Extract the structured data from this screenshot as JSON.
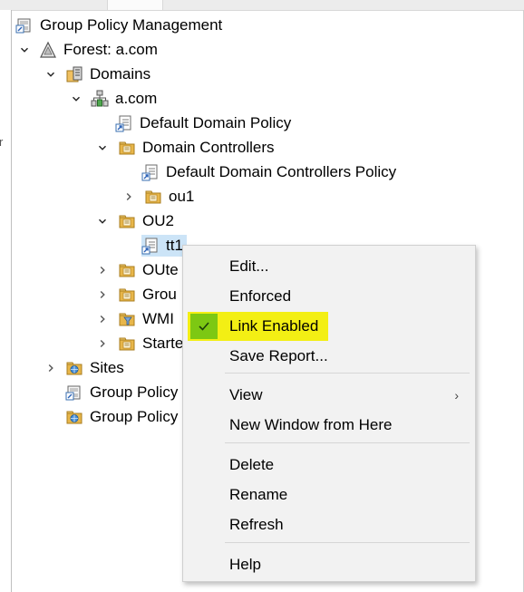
{
  "tree": {
    "root": "Group Policy Management",
    "forest": "Forest: a.com",
    "domains": "Domains",
    "domain": "a.com",
    "ddp": "Default Domain Policy",
    "dc": "Domain Controllers",
    "ddcp": "Default Domain Controllers Policy",
    "ou1": "ou1",
    "ou2": "OU2",
    "tt1": "tt1",
    "oute": "OUte",
    "grou": "Grou",
    "wmi": "WMI",
    "starte": "Starte",
    "sites": "Sites",
    "gpm1": "Group Policy",
    "gpm2": "Group Policy"
  },
  "left_fragment": "r",
  "context_menu": {
    "edit": "Edit...",
    "enforced": "Enforced",
    "link_enabled": "Link Enabled",
    "save_report": "Save Report...",
    "view": "View",
    "new_window": "New Window from Here",
    "delete": "Delete",
    "rename": "Rename",
    "refresh": "Refresh",
    "help": "Help"
  },
  "colors": {
    "highlight": "#f3ef14",
    "check_box": "#7dc813",
    "selection": "#cce4f7",
    "menu_bg": "#f2f2f2"
  }
}
